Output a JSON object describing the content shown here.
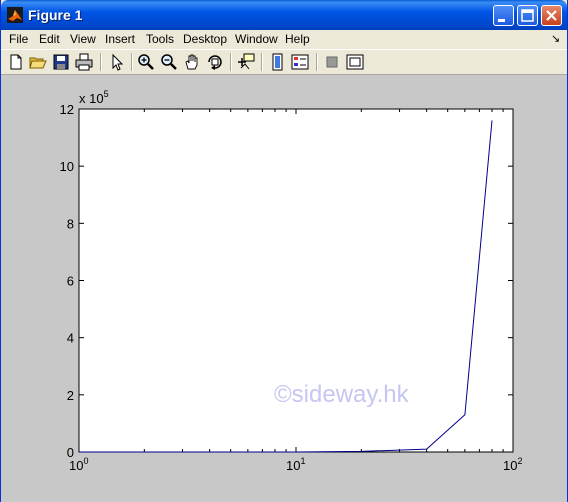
{
  "window": {
    "title": "Figure 1"
  },
  "menu": [
    "File",
    "Edit",
    "View",
    "Insert",
    "Tools",
    "Desktop",
    "Window",
    "Help"
  ],
  "menu_arrow": "↘",
  "toolbar_icons": [
    "new-figure-icon",
    "open-file-icon",
    "save-icon",
    "print-icon",
    "edit-plot-icon",
    "zoom-in-icon",
    "zoom-out-icon",
    "pan-icon",
    "rotate-3d-icon",
    "data-cursor-icon",
    "colorbar-icon",
    "legend-icon",
    "hide-plot-tools-icon",
    "show-plot-tools-icon"
  ],
  "watermark": "©sideway.hk",
  "colors": {
    "line": "#00008b",
    "titlebar": "#0055e5",
    "figure_bg": "#c8c8c8"
  },
  "chart_data": {
    "type": "line",
    "x_scale": "log",
    "xlim": [
      1,
      100
    ],
    "ylim": [
      0,
      1200000
    ],
    "y_multiplier": "x 10^5",
    "y_multiplier_base": "x 10",
    "y_multiplier_exp": "5",
    "x_ticks": [
      {
        "value": 1,
        "base": "10",
        "exp": "0"
      },
      {
        "value": 10,
        "base": "10",
        "exp": "1"
      },
      {
        "value": 100,
        "base": "10",
        "exp": "2"
      }
    ],
    "y_ticks": [
      "0",
      "2",
      "4",
      "6",
      "8",
      "10",
      "12"
    ],
    "grid": false,
    "series": [
      {
        "x": [
          1,
          2,
          5,
          10,
          20,
          40,
          60,
          80
        ],
        "y": [
          0,
          0,
          0,
          0,
          2000,
          10000,
          130000,
          1160000
        ]
      }
    ]
  }
}
